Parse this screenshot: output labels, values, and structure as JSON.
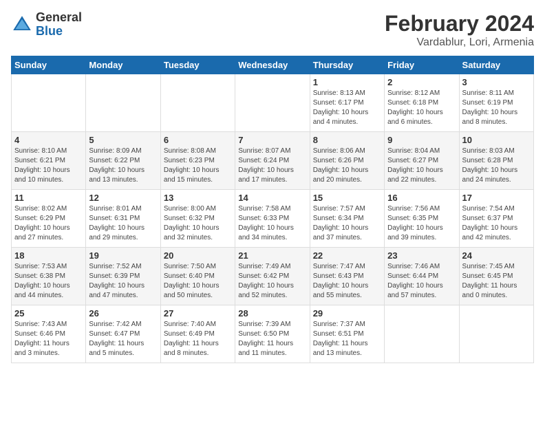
{
  "logo": {
    "general": "General",
    "blue": "Blue"
  },
  "title": "February 2024",
  "subtitle": "Vardablur, Lori, Armenia",
  "days_of_week": [
    "Sunday",
    "Monday",
    "Tuesday",
    "Wednesday",
    "Thursday",
    "Friday",
    "Saturday"
  ],
  "weeks": [
    [
      {
        "day": "",
        "detail": ""
      },
      {
        "day": "",
        "detail": ""
      },
      {
        "day": "",
        "detail": ""
      },
      {
        "day": "",
        "detail": ""
      },
      {
        "day": "1",
        "detail": "Sunrise: 8:13 AM\nSunset: 6:17 PM\nDaylight: 10 hours\nand 4 minutes."
      },
      {
        "day": "2",
        "detail": "Sunrise: 8:12 AM\nSunset: 6:18 PM\nDaylight: 10 hours\nand 6 minutes."
      },
      {
        "day": "3",
        "detail": "Sunrise: 8:11 AM\nSunset: 6:19 PM\nDaylight: 10 hours\nand 8 minutes."
      }
    ],
    [
      {
        "day": "4",
        "detail": "Sunrise: 8:10 AM\nSunset: 6:21 PM\nDaylight: 10 hours\nand 10 minutes."
      },
      {
        "day": "5",
        "detail": "Sunrise: 8:09 AM\nSunset: 6:22 PM\nDaylight: 10 hours\nand 13 minutes."
      },
      {
        "day": "6",
        "detail": "Sunrise: 8:08 AM\nSunset: 6:23 PM\nDaylight: 10 hours\nand 15 minutes."
      },
      {
        "day": "7",
        "detail": "Sunrise: 8:07 AM\nSunset: 6:24 PM\nDaylight: 10 hours\nand 17 minutes."
      },
      {
        "day": "8",
        "detail": "Sunrise: 8:06 AM\nSunset: 6:26 PM\nDaylight: 10 hours\nand 20 minutes."
      },
      {
        "day": "9",
        "detail": "Sunrise: 8:04 AM\nSunset: 6:27 PM\nDaylight: 10 hours\nand 22 minutes."
      },
      {
        "day": "10",
        "detail": "Sunrise: 8:03 AM\nSunset: 6:28 PM\nDaylight: 10 hours\nand 24 minutes."
      }
    ],
    [
      {
        "day": "11",
        "detail": "Sunrise: 8:02 AM\nSunset: 6:29 PM\nDaylight: 10 hours\nand 27 minutes."
      },
      {
        "day": "12",
        "detail": "Sunrise: 8:01 AM\nSunset: 6:31 PM\nDaylight: 10 hours\nand 29 minutes."
      },
      {
        "day": "13",
        "detail": "Sunrise: 8:00 AM\nSunset: 6:32 PM\nDaylight: 10 hours\nand 32 minutes."
      },
      {
        "day": "14",
        "detail": "Sunrise: 7:58 AM\nSunset: 6:33 PM\nDaylight: 10 hours\nand 34 minutes."
      },
      {
        "day": "15",
        "detail": "Sunrise: 7:57 AM\nSunset: 6:34 PM\nDaylight: 10 hours\nand 37 minutes."
      },
      {
        "day": "16",
        "detail": "Sunrise: 7:56 AM\nSunset: 6:35 PM\nDaylight: 10 hours\nand 39 minutes."
      },
      {
        "day": "17",
        "detail": "Sunrise: 7:54 AM\nSunset: 6:37 PM\nDaylight: 10 hours\nand 42 minutes."
      }
    ],
    [
      {
        "day": "18",
        "detail": "Sunrise: 7:53 AM\nSunset: 6:38 PM\nDaylight: 10 hours\nand 44 minutes."
      },
      {
        "day": "19",
        "detail": "Sunrise: 7:52 AM\nSunset: 6:39 PM\nDaylight: 10 hours\nand 47 minutes."
      },
      {
        "day": "20",
        "detail": "Sunrise: 7:50 AM\nSunset: 6:40 PM\nDaylight: 10 hours\nand 50 minutes."
      },
      {
        "day": "21",
        "detail": "Sunrise: 7:49 AM\nSunset: 6:42 PM\nDaylight: 10 hours\nand 52 minutes."
      },
      {
        "day": "22",
        "detail": "Sunrise: 7:47 AM\nSunset: 6:43 PM\nDaylight: 10 hours\nand 55 minutes."
      },
      {
        "day": "23",
        "detail": "Sunrise: 7:46 AM\nSunset: 6:44 PM\nDaylight: 10 hours\nand 57 minutes."
      },
      {
        "day": "24",
        "detail": "Sunrise: 7:45 AM\nSunset: 6:45 PM\nDaylight: 11 hours\nand 0 minutes."
      }
    ],
    [
      {
        "day": "25",
        "detail": "Sunrise: 7:43 AM\nSunset: 6:46 PM\nDaylight: 11 hours\nand 3 minutes."
      },
      {
        "day": "26",
        "detail": "Sunrise: 7:42 AM\nSunset: 6:47 PM\nDaylight: 11 hours\nand 5 minutes."
      },
      {
        "day": "27",
        "detail": "Sunrise: 7:40 AM\nSunset: 6:49 PM\nDaylight: 11 hours\nand 8 minutes."
      },
      {
        "day": "28",
        "detail": "Sunrise: 7:39 AM\nSunset: 6:50 PM\nDaylight: 11 hours\nand 11 minutes."
      },
      {
        "day": "29",
        "detail": "Sunrise: 7:37 AM\nSunset: 6:51 PM\nDaylight: 11 hours\nand 13 minutes."
      },
      {
        "day": "",
        "detail": ""
      },
      {
        "day": "",
        "detail": ""
      }
    ]
  ]
}
